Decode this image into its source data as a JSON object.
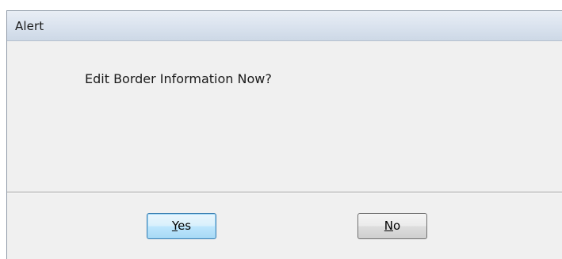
{
  "window": {
    "title": "Alert"
  },
  "message": "Edit Border Information Now?",
  "buttons": {
    "yes": {
      "mnemonic": "Y",
      "rest": "es"
    },
    "no": {
      "mnemonic": "N",
      "rest": "o"
    }
  },
  "colors": {
    "dialog_background": "#f0f0f0",
    "default_button_border": "#3c7fb1"
  }
}
